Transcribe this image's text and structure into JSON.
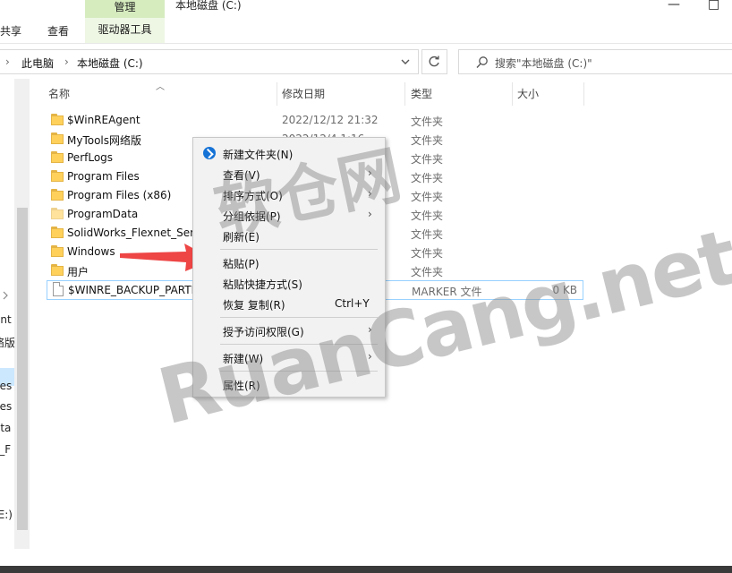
{
  "window": {
    "title": "本地磁盘 (C:)",
    "minimize": "—",
    "maximize": "□"
  },
  "ribbon": {
    "tabs": [
      "共享",
      "查看"
    ],
    "context_group": "管理",
    "context_tab": "驱动器工具"
  },
  "address": {
    "sep": "›",
    "crumbs": [
      "此电脑",
      "本地磁盘 (C:)"
    ]
  },
  "search": {
    "placeholder": "搜索\"本地磁盘 (C:)\""
  },
  "columns": {
    "name": "名称",
    "date": "修改日期",
    "type": "类型",
    "size": "大小"
  },
  "rows": [
    {
      "name": "$WinREAgent",
      "date": "2022/12/12 21:32",
      "type": "文件夹",
      "size": "",
      "icon": "folder-icon"
    },
    {
      "name": "MyTools网络版",
      "date": "2022/12/4 1:16",
      "type": "文件夹",
      "size": "",
      "icon": "folder-icon"
    },
    {
      "name": "PerfLogs",
      "date": "",
      "type": "文件夹",
      "size": "",
      "icon": "folder-icon"
    },
    {
      "name": "Program Files",
      "date": "",
      "type": "文件夹",
      "size": "",
      "icon": "folder-icon"
    },
    {
      "name": "Program Files (x86)",
      "date": "",
      "type": "文件夹",
      "size": "",
      "icon": "folder-icon"
    },
    {
      "name": "ProgramData",
      "date": "",
      "type": "文件夹",
      "size": "",
      "icon": "folder-icon"
    },
    {
      "name": "SolidWorks_Flexnet_Serv",
      "date": "",
      "type": "文件夹",
      "size": "",
      "icon": "folder-icon"
    },
    {
      "name": "Windows",
      "date": "",
      "type": "文件夹",
      "size": "",
      "icon": "folder-icon"
    },
    {
      "name": "用户",
      "date": "",
      "type": "文件夹",
      "size": "",
      "icon": "folder-icon"
    },
    {
      "name": "$WINRE_BACKUP_PARTI",
      "date": "",
      "type": "MARKER 文件",
      "size": "0 KB",
      "icon": "file-icon"
    }
  ],
  "nav_fragments": [
    "ent",
    "络版",
    "iles",
    "iles",
    "ata",
    "s_F",
    "(E:)"
  ],
  "context_menu": {
    "new_folder": "新建文件夹(N)",
    "view": "查看(V)",
    "sort_by": "排序方式(O)",
    "group_by": "分组依据(P)",
    "refresh": "刷新(E)",
    "paste": "粘贴(P)",
    "paste_shortcut": "粘贴快捷方式(S)",
    "undo_copy": "恢复 复制(R)",
    "undo_shortcut": "Ctrl+Y",
    "grant_access": "授予访问权限(G)",
    "new": "新建(W)",
    "properties": "属性(R)",
    "submenu_arrow": "›"
  },
  "watermark": {
    "line1": "软仓网",
    "line2": "RuanCang.net"
  }
}
